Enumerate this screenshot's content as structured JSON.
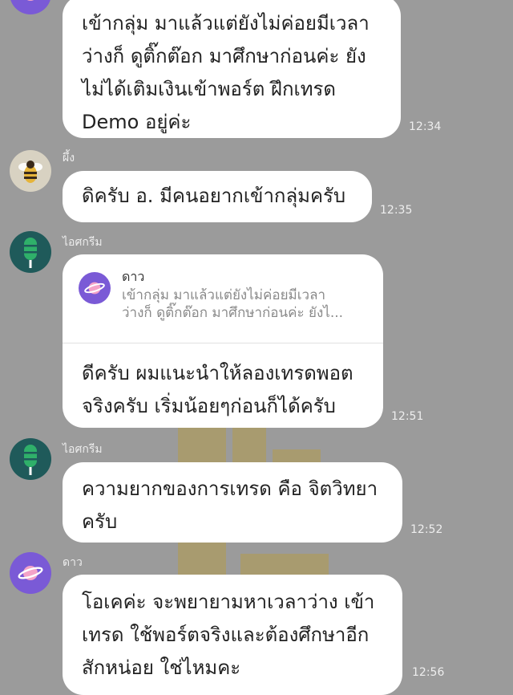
{
  "messages": [
    {
      "text": "เข้ากลุ่ม มาแล้วแต่ยังไม่ค่อยมีเวลา\nว่างก็ ดูติ๊กต๊อก  มาศึกษาก่อนค่ะ ยัง\nไม่ได้เติมเงินเข้าพอร์ต ฝึกเทรด\nDemo อยู่ค่ะ",
      "time": "12:34"
    },
    {
      "sender": "ผึ้ง",
      "text": "ดิครับ อ. มีคนอยากเข้ากลุ่มครับ",
      "time": "12:35"
    },
    {
      "sender": "ไอศกรีม",
      "quote": {
        "name": "ดาว",
        "text": "เข้ากลุ่ม มาแล้วแต่ยังไม่ค่อยมีเวลา\nว่างก็ ดูติ๊กต๊อก มาศึกษาก่อนค่ะ ยังไ..."
      },
      "text": "ดีครับ ผมแนะนำให้ลองเทรดพอต\nจริงครับ เริ่มน้อยๆก่อนก็ได้ครับ",
      "time": "12:51"
    },
    {
      "sender": "ไอศกรีม",
      "text": "ความยากของการเทรด คือ จิตวิทยา\nครับ",
      "time": "12:52"
    },
    {
      "sender": "ดาว",
      "text": "โอเคค่ะ จะพยายามหาเวลาว่าง เข้า\nเทรด ใช้พอร์ตจริงและต้องศึกษาอีก\nสักหน่อย ใช่ไหมคะ",
      "time": "12:56"
    }
  ],
  "colors": {
    "background": "#9b9b9b",
    "bubble": "#ffffff",
    "planet_avatar": "#7a5ad6",
    "icecream_avatar_bg": "#1f5a5a",
    "icecream_avatar_fg": "#2fb06a",
    "bee_avatar_bg": "#d8d2c2"
  },
  "icons": [
    "planet-icon",
    "bee-icon",
    "icecream-icon"
  ]
}
